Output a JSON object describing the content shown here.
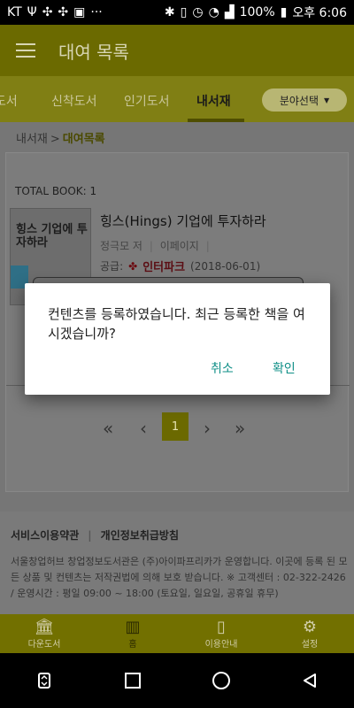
{
  "status_bar": {
    "carrier": "KT",
    "battery": "100%",
    "time": "오후 6:06"
  },
  "app_bar": {
    "title": "대여 목록"
  },
  "tabs": [
    "도서",
    "신착도서",
    "인기도서",
    "내서재"
  ],
  "category_button": {
    "label": "분야선택"
  },
  "breadcrumb": {
    "parent": "내서재",
    "current": "대여목록"
  },
  "total": "TOTAL BOOK: 1",
  "book": {
    "title": "힝스(Hings) 기업에 투자하라",
    "author": "정극모 저",
    "publisher": "이페이지",
    "supply_label": "공급:",
    "supplier": "인터파크",
    "date": "(2018-06-01)",
    "cover_text": "힝스 기업에 투자하라"
  },
  "pager": {
    "first": "«",
    "prev": "‹",
    "current": "1",
    "next": "›",
    "last": "»"
  },
  "footer": {
    "terms": "서비스이용약관",
    "privacy": "개인정보취급방침",
    "text": "서울창업허브 창업정보도서관은 (주)아이파프리카가 운영합니다. 이곳에 등록 된 모든 상품 및 컨텐츠는 저작권법에 의해 보호 받습니다. ※ 고객센터 : 02-322-2426 / 운영시간 : 평일 09:00 ~ 18:00 (토요일, 일요일, 공휴일 휴무)"
  },
  "bottom_nav": [
    {
      "label": "다운도서",
      "icon": "library-icon"
    },
    {
      "label": "홈",
      "icon": "books-icon"
    },
    {
      "label": "이용안내",
      "icon": "book-icon"
    },
    {
      "label": "설정",
      "icon": "gear-icon"
    }
  ],
  "dialog": {
    "message": "컨텐츠를 등록하였습니다. 최근 등록한 책을 여시겠습니까?",
    "cancel": "취소",
    "ok": "확인"
  }
}
